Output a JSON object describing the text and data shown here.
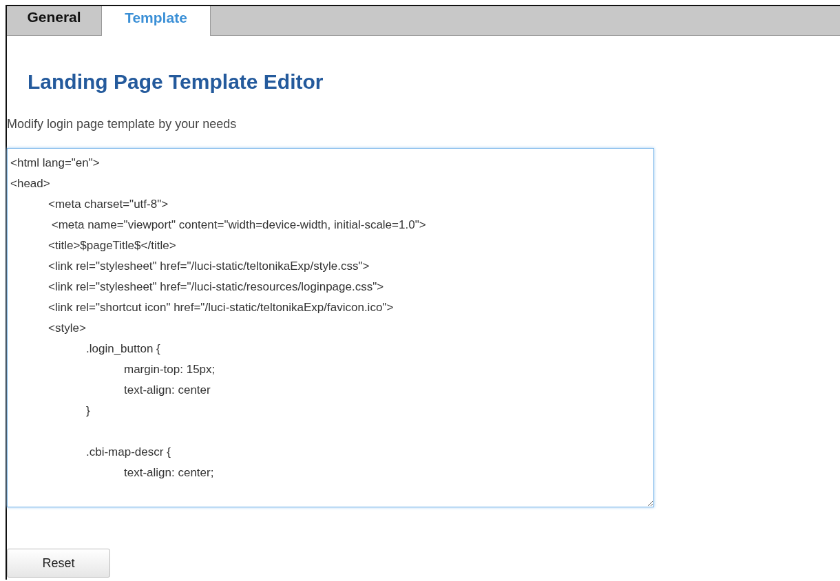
{
  "tabs": [
    {
      "label": "General",
      "selected": false
    },
    {
      "label": "Template",
      "selected": true
    }
  ],
  "heading": "Landing Page Template Editor",
  "description": "Modify login page template by your needs",
  "editor": {
    "value": "<html lang=\"en\">\n<head>\n\t<meta charset=\"utf-8\">\n\t <meta name=\"viewport\" content=\"width=device-width, initial-scale=1.0\">\n\t<title>$pageTitle$</title>\n\t<link rel=\"stylesheet\" href=\"/luci-static/teltonikaExp/style.css\">\n\t<link rel=\"stylesheet\" href=\"/luci-static/resources/loginpage.css\">\n\t<link rel=\"shortcut icon\" href=\"/luci-static/teltonikaExp/favicon.ico\">\n\t<style>\n\t\t.login_button {\n\t\t\tmargin-top: 15px;\n\t\t\ttext-align: center\n\t\t}\n\n\t\t.cbi-map-descr {\n\t\t\ttext-align: center;"
  },
  "buttons": [
    {
      "label": "Reset"
    }
  ]
}
